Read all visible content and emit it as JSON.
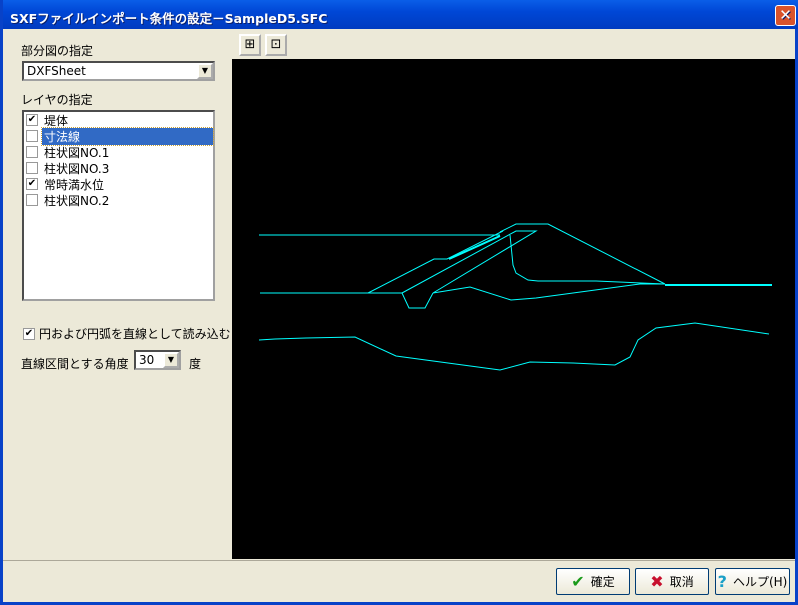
{
  "title": "SXFファイルインポート条件の設定－SampleD5.SFC",
  "partial_view": {
    "label": "部分図の指定",
    "value": "DXFSheet"
  },
  "layers": {
    "label": "レイヤの指定",
    "items": [
      {
        "label": "堤体",
        "checked": true,
        "selected": false
      },
      {
        "label": "寸法線",
        "checked": false,
        "selected": true
      },
      {
        "label": "柱状図NO.1",
        "checked": false,
        "selected": false
      },
      {
        "label": "柱状図NO.3",
        "checked": false,
        "selected": false
      },
      {
        "label": "常時満水位",
        "checked": true,
        "selected": false
      },
      {
        "label": "柱状図NO.2",
        "checked": false,
        "selected": false
      }
    ]
  },
  "arc_option": {
    "label": "円および円弧を直線として読み込む",
    "checked": true
  },
  "angle": {
    "label": "直線区間とする角度",
    "value": "30",
    "unit": "度"
  },
  "buttons": {
    "ok": "確定",
    "cancel": "取消",
    "help": "ヘルプ(H)"
  },
  "drawing_color": "#00ffff"
}
